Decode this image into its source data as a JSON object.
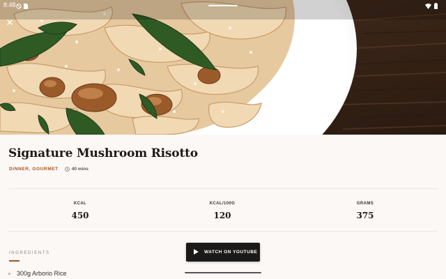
{
  "status_bar": {
    "time": "8:48",
    "left_icons": [
      "do-not-disturb-icon",
      "sim-card-icon"
    ],
    "right_icons": [
      "wifi-icon",
      "battery-icon"
    ]
  },
  "hero": {
    "image": "mushroom-pasta-photo",
    "close_icon": "close-icon"
  },
  "recipe": {
    "title": "Signature Mushroom Risotto",
    "categories": "DINNER, GOURMET",
    "duration": "40 mins",
    "duration_icon": "clock-icon"
  },
  "nutrition": [
    {
      "label": "KCAL",
      "value": "450"
    },
    {
      "label": "KCAL/100G",
      "value": "120"
    },
    {
      "label": "GRAMS",
      "value": "375"
    }
  ],
  "ingredients": {
    "heading": "INGREDIENTS",
    "items": [
      "300g Arborio Rice"
    ]
  },
  "actions": {
    "watch_label": "WATCH ON YOUTUBE",
    "watch_icon": "play-icon"
  },
  "colors": {
    "accent": "#a3531d",
    "background": "#fcf8f6",
    "button": "#1c1a19"
  }
}
